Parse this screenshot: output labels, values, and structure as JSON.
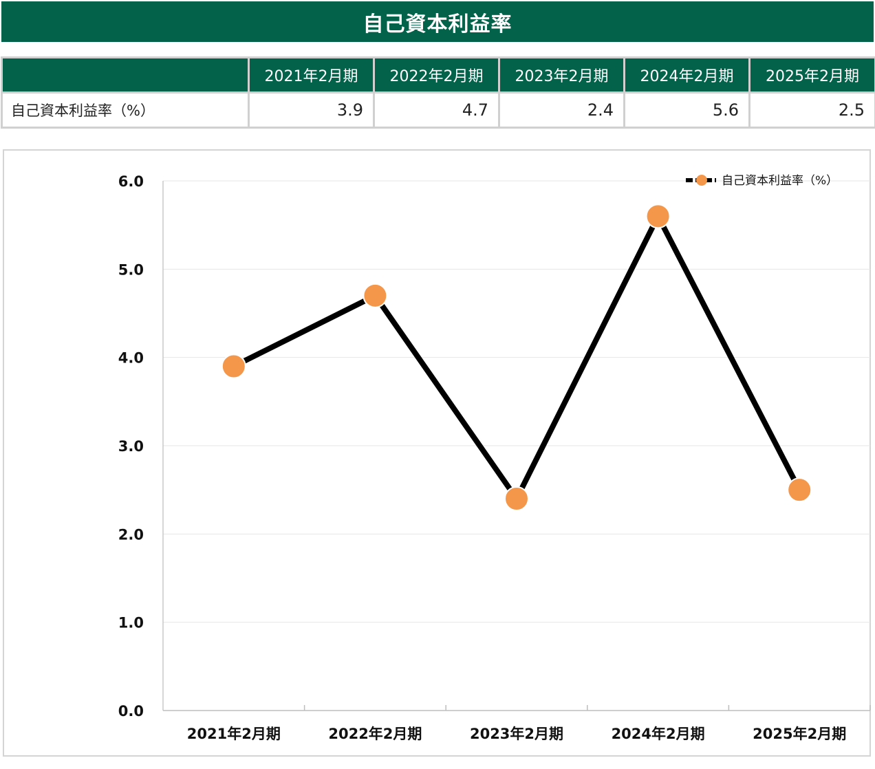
{
  "title": "自己資本利益率",
  "table": {
    "corner": "",
    "headers": [
      "2021年2月期",
      "2022年2月期",
      "2023年2月期",
      "2024年2月期",
      "2025年2月期"
    ],
    "row_label": "自己資本利益率（%）",
    "values": [
      "3.9",
      "4.7",
      "2.4",
      "5.6",
      "2.5"
    ]
  },
  "colors": {
    "header_green": "#02624a",
    "line": "#000000",
    "marker": "#f4974a",
    "grid": "#e6e6e6",
    "border": "#d0d0d0"
  },
  "chart_data": {
    "type": "line",
    "categories": [
      "2021年2月期",
      "2022年2月期",
      "2023年2月期",
      "2024年2月期",
      "2025年2月期"
    ],
    "series": [
      {
        "name": "自己資本利益率（%）",
        "values": [
          3.9,
          4.7,
          2.4,
          5.6,
          2.5
        ]
      }
    ],
    "ylim": [
      0,
      6
    ],
    "yticks": [
      "0.0",
      "1.0",
      "2.0",
      "3.0",
      "4.0",
      "5.0",
      "6.0"
    ],
    "grid": true,
    "legend": "top-right"
  }
}
